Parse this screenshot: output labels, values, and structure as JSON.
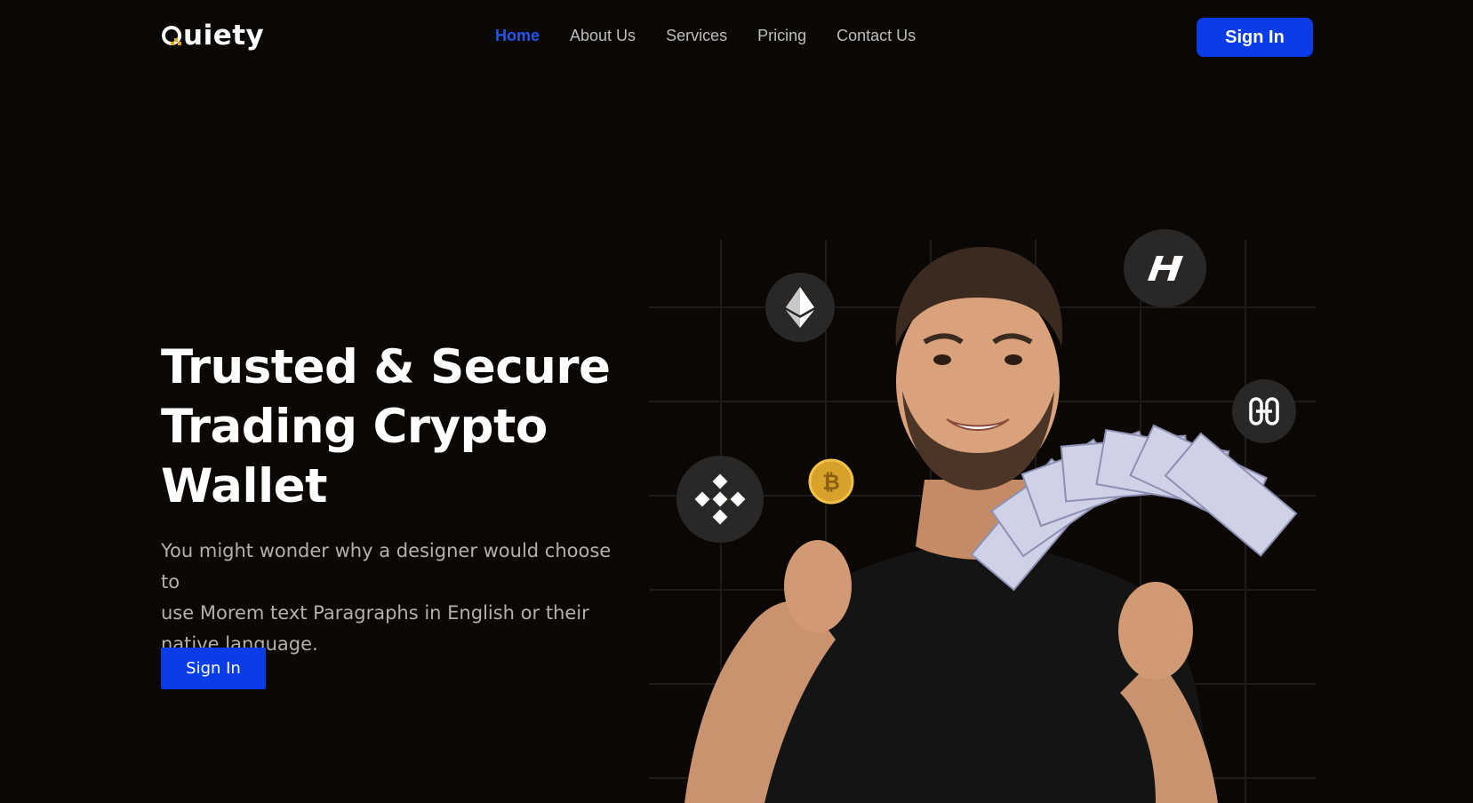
{
  "header": {
    "logo_text": "uiety",
    "logo_icon": "q-logo-icon",
    "nav": [
      {
        "label": "Home",
        "active": true
      },
      {
        "label": "About Us",
        "active": false
      },
      {
        "label": "Services",
        "active": false
      },
      {
        "label": "Pricing",
        "active": false
      },
      {
        "label": "Contact Us",
        "active": false
      }
    ],
    "signin_label": "Sign In"
  },
  "hero": {
    "title_lines": [
      "Trusted & Secure",
      "Trading Crypto",
      "Wallet"
    ],
    "description_lines": [
      "You might wonder why a designer would choose to",
      "use Morem text Paragraphs in English or their",
      "native language."
    ],
    "signin_label": "Sign In"
  },
  "visual": {
    "photo": "man-holding-bitcoin-and-cash-photo",
    "icons": [
      "ethereum-icon",
      "hedera-icon",
      "harmony-icon",
      "binance-icon",
      "bitcoin-coin-icon",
      "dollar-bills-fan"
    ]
  },
  "colors": {
    "background": "#0b0704",
    "accent": "#0a3de8",
    "nav_active": "#1f55f2",
    "nav_text": "#bdbdbd",
    "body_text": "#b4b0ab",
    "icon_badge": "#2a2826"
  }
}
